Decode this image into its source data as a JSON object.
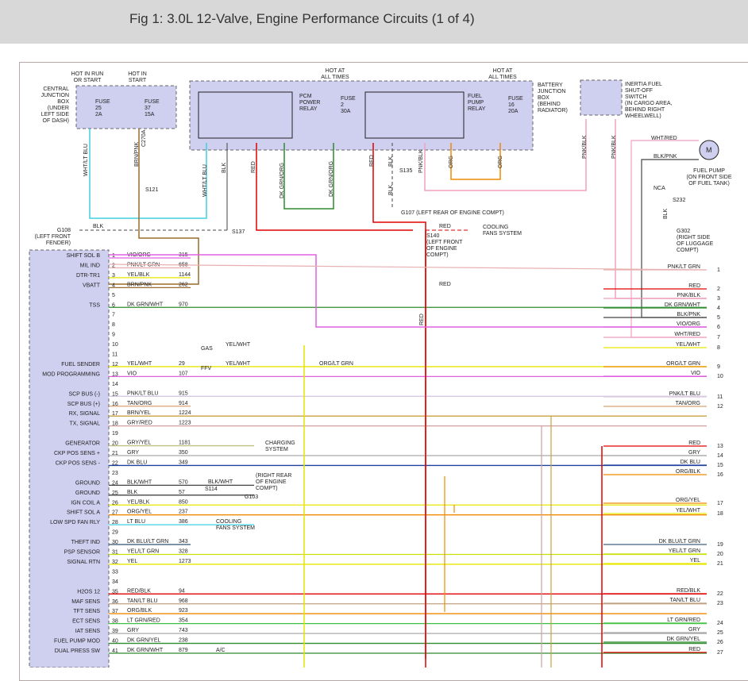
{
  "figure": {
    "title": "Fig 1: 3.0L 12-Valve, Engine Performance Circuits (1 of 4)"
  },
  "colors": {
    "purple": "#cfcff0",
    "wire_red": "#e00000",
    "wire_green": "#2e8b2e",
    "wire_pink": "#e060e0",
    "wire_yellow": "#e6e600",
    "wire_orange": "#f08a00",
    "wire_brown": "#9c6a2e",
    "wire_cyan": "#40d0e0"
  },
  "boxes": {
    "cjb": {
      "label": "CENTRAL\nJUNCTION\nBOX\n(UNDER\nLEFT SIDE\nOF DASH)"
    },
    "bjb": {
      "label": "BATTERY\nJUNCTION\nBOX\n(BEHIND\nRADIATOR)"
    },
    "pcm_relay": {
      "label": "PCM\nPOWER\nRELAY"
    },
    "fp_relay": {
      "label": "FUEL\nPUMP\nRELAY"
    },
    "inertia": {
      "label": "INERTIA FUEL\nSHUT-OFF\nSWITCH\n(IN CARGO AREA,\nBEHIND RIGHT\nWHEELWELL)"
    },
    "fuel_pump": {
      "label": "FUEL PUMP\n(ON FRONT SIDE\nOF FUEL TANK)"
    }
  },
  "top_labels": {
    "hot_run_start": "HOT IN RUN\nOR START",
    "hot_start": "HOT IN\nSTART",
    "hot_all_1": "HOT AT\nALL TIMES",
    "hot_all_2": "HOT AT\nALL TIMES",
    "fuse25": "FUSE\n25\n2A",
    "fuse37": "FUSE\n37\n15A",
    "fuse2": "FUSE\n2\n30A",
    "fuse16": "FUSE\n16\n20A"
  },
  "splices": {
    "s121": "S121",
    "s137": "S137",
    "s135": "S135",
    "s140": "S140\n(LEFT FRONT\nOF ENGINE\nCOMPT)",
    "s232": "S232",
    "s114": "S114",
    "nca": "NCA"
  },
  "grounds": {
    "g108": "G108\n(LEFT FRONT\nFENDER)",
    "g107": "G107 (LEFT REAR OF ENGINE COMPT)",
    "g302": "G302\n(RIGHT SIDE\nOF LUGGAGE\nCOMPT)",
    "g103": "G103",
    "g103_loc": "(RIGHT REAR\nOF ENGINE\nCOMPT)"
  },
  "wire_labels": {
    "wht_lt_blu": "WHT/LT BLU",
    "brn_pnk": "BRN/PNK",
    "c270a": "C270A",
    "blk": "BLK",
    "red": "RED",
    "dk_grn_org": "DK GRN/ORG",
    "pnk_blk": "PNK/BLK",
    "org": "ORG",
    "wht_red": "WHT/RED",
    "blk_pnk": "BLK/PNK",
    "blk_wht": "BLK/WHT",
    "gas": "GAS",
    "ffv": "FFV",
    "yel_wht": "YEL/WHT",
    "org_lt_grn": "ORG/LT GRN",
    "cooling_fans": "COOLING\nFANS SYSTEM",
    "charging": "CHARGING\nSYSTEM",
    "ac": "A/C"
  },
  "connector": {
    "pin_names": [
      "SHIFT SOL B",
      "MIL IND",
      "DTR-TR1",
      "VBATT",
      "",
      "TSS",
      "",
      "",
      "",
      "",
      "",
      "FUEL SENDER",
      "MOD PROGRAMMING",
      "",
      "SCP BUS (-)",
      "SCP BUS (+)",
      "RX, SIGNAL",
      "TX, SIGNAL",
      "",
      "GENERATOR",
      "CKP POS SENS +",
      "CKP POS SENS -",
      "",
      "GROUND",
      "GROUND",
      "IGN COIL A",
      "SHIFT SOL A",
      "LOW SPD FAN RLY",
      "",
      "THEFT IND",
      "PSP SENSOR",
      "SIGNAL RTN",
      "",
      "",
      "H2OS 12",
      "MAF SENS",
      "TFT SENS",
      "ECT SENS",
      "IAT SENS",
      "FUEL PUMP MOD",
      "DUAL PRESS SW"
    ],
    "pin_numbers": [
      "1",
      "2",
      "3",
      "4",
      "5",
      "6",
      "7",
      "8",
      "9",
      "10",
      "11",
      "12",
      "13",
      "14",
      "15",
      "16",
      "17",
      "18",
      "19",
      "20",
      "21",
      "22",
      "23",
      "24",
      "25",
      "26",
      "27",
      "28",
      "29",
      "30",
      "31",
      "32",
      "33",
      "34",
      "35",
      "36",
      "37",
      "38",
      "39",
      "40",
      "41"
    ],
    "wire_colors": [
      "VIO/ORG",
      "PNK/LT GRN",
      "YEL/BLK",
      "BRN/PNK",
      "",
      "DK GRN/WHT",
      "",
      "",
      "",
      "",
      "",
      "YEL/WHT",
      "VIO",
      "",
      "PNK/LT BLU",
      "TAN/ORG",
      "BRN/YEL",
      "GRY/RED",
      "",
      "GRY/YEL",
      "GRY",
      "DK BLU",
      "",
      "BLK/WHT",
      "BLK",
      "YEL/BLK",
      "ORG/YEL",
      "LT BLU",
      "",
      "DK BLU/LT GRN",
      "YEL/LT GRN",
      "YEL",
      "",
      "",
      "RED/BLK",
      "TAN/LT BLU",
      "ORG/BLK",
      "LT GRN/RED",
      "GRY",
      "DK GRN/YEL",
      "DK GRN/WHT"
    ],
    "circuits": [
      "315",
      "658",
      "1144",
      "262",
      "",
      "970",
      "",
      "",
      "",
      "",
      "",
      "29",
      "107",
      "",
      "915",
      "914",
      "1224",
      "1223",
      "",
      "1181",
      "350",
      "349",
      "",
      "570",
      "57",
      "850",
      "237",
      "386",
      "",
      "343",
      "328",
      "1273",
      "",
      "",
      "94",
      "968",
      "923",
      "354",
      "743",
      "238",
      "879"
    ]
  },
  "right_harness": {
    "colors": [
      "PNK/LT GRN",
      "RED",
      "PNK/BLK",
      "DK GRN/WHT",
      "BLK/PNK",
      "VIO/ORG",
      "WHT/RED",
      "YEL/WHT",
      "ORG/LT GRN",
      "VIO",
      "PNK/LT BLU",
      "TAN/ORG",
      "RED",
      "GRY",
      "DK BLU",
      "ORG/BLK",
      "ORG/YEL",
      "YEL/WHT",
      "DK BLU/LT GRN",
      "YEL/LT GRN",
      "YEL",
      "RED/BLK",
      "TAN/LT BLU",
      "LT GRN/RED",
      "GRY",
      "DK GRN/YEL",
      "RED"
    ],
    "numbers": [
      "1",
      "2",
      "3",
      "4",
      "5",
      "6",
      "7",
      "8",
      "9",
      "10",
      "11",
      "12",
      "13",
      "14",
      "15",
      "16",
      "17",
      "18",
      "19",
      "20",
      "21",
      "22",
      "23",
      "24",
      "25",
      "26",
      "27"
    ]
  }
}
